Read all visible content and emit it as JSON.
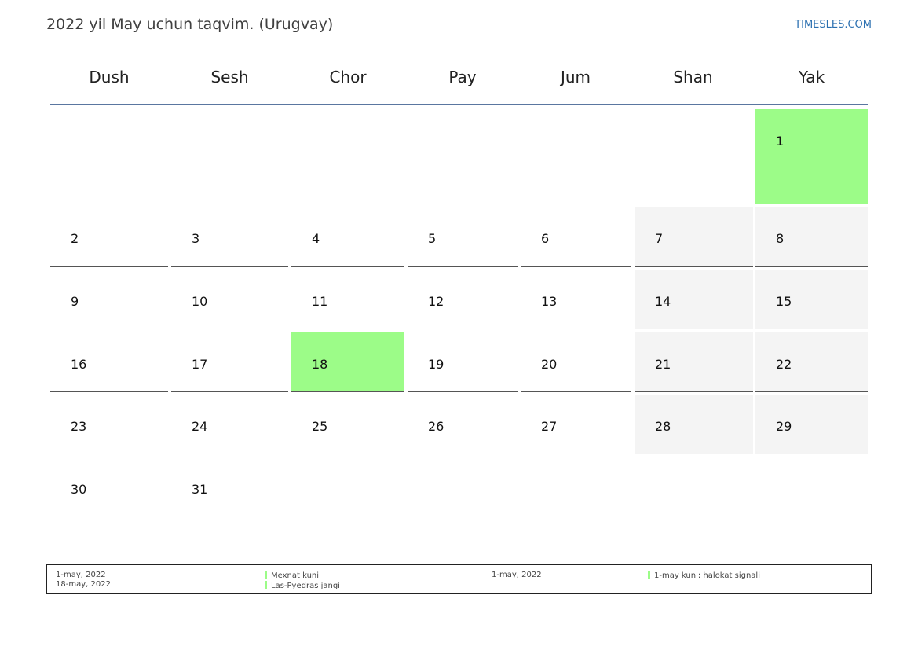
{
  "header": {
    "title": "2022 yil May uchun taqvim. (Urugvay)",
    "site": "TIMESLES.COM"
  },
  "weekdays": [
    "Dush",
    "Sesh",
    "Chor",
    "Pay",
    "Jum",
    "Shan",
    "Yak"
  ],
  "colors": {
    "holiday": "#9cfc88",
    "weekend": "#f4f4f4",
    "header_rule": "#5a76a0",
    "link": "#2a6fb0"
  },
  "weeks": [
    [
      {
        "day": "",
        "type": "normal"
      },
      {
        "day": "",
        "type": "normal"
      },
      {
        "day": "",
        "type": "normal"
      },
      {
        "day": "",
        "type": "normal"
      },
      {
        "day": "",
        "type": "normal"
      },
      {
        "day": "",
        "type": "normal"
      },
      {
        "day": "1",
        "type": "holiday"
      }
    ],
    [
      {
        "day": "2",
        "type": "normal"
      },
      {
        "day": "3",
        "type": "normal"
      },
      {
        "day": "4",
        "type": "normal"
      },
      {
        "day": "5",
        "type": "normal"
      },
      {
        "day": "6",
        "type": "normal"
      },
      {
        "day": "7",
        "type": "weekend"
      },
      {
        "day": "8",
        "type": "weekend"
      }
    ],
    [
      {
        "day": "9",
        "type": "normal"
      },
      {
        "day": "10",
        "type": "normal"
      },
      {
        "day": "11",
        "type": "normal"
      },
      {
        "day": "12",
        "type": "normal"
      },
      {
        "day": "13",
        "type": "normal"
      },
      {
        "day": "14",
        "type": "weekend"
      },
      {
        "day": "15",
        "type": "weekend"
      }
    ],
    [
      {
        "day": "16",
        "type": "normal"
      },
      {
        "day": "17",
        "type": "normal"
      },
      {
        "day": "18",
        "type": "holiday"
      },
      {
        "day": "19",
        "type": "normal"
      },
      {
        "day": "20",
        "type": "normal"
      },
      {
        "day": "21",
        "type": "weekend"
      },
      {
        "day": "22",
        "type": "weekend"
      }
    ],
    [
      {
        "day": "23",
        "type": "normal"
      },
      {
        "day": "24",
        "type": "normal"
      },
      {
        "day": "25",
        "type": "normal"
      },
      {
        "day": "26",
        "type": "normal"
      },
      {
        "day": "27",
        "type": "normal"
      },
      {
        "day": "28",
        "type": "weekend"
      },
      {
        "day": "29",
        "type": "weekend"
      }
    ],
    [
      {
        "day": "30",
        "type": "normal"
      },
      {
        "day": "31",
        "type": "normal"
      },
      {
        "day": "",
        "type": "normal"
      },
      {
        "day": "",
        "type": "normal"
      },
      {
        "day": "",
        "type": "normal"
      },
      {
        "day": "",
        "type": "normal"
      },
      {
        "day": "",
        "type": "normal"
      }
    ]
  ],
  "legend": {
    "left": {
      "dates": [
        "1-may, 2022",
        "18-may, 2022"
      ],
      "names": [
        "Mexnat kuni",
        "Las-Pyedras jangi"
      ]
    },
    "right": {
      "dates": [
        "1-may, 2022"
      ],
      "names": [
        "1-may kuni; halokat signali"
      ]
    }
  }
}
